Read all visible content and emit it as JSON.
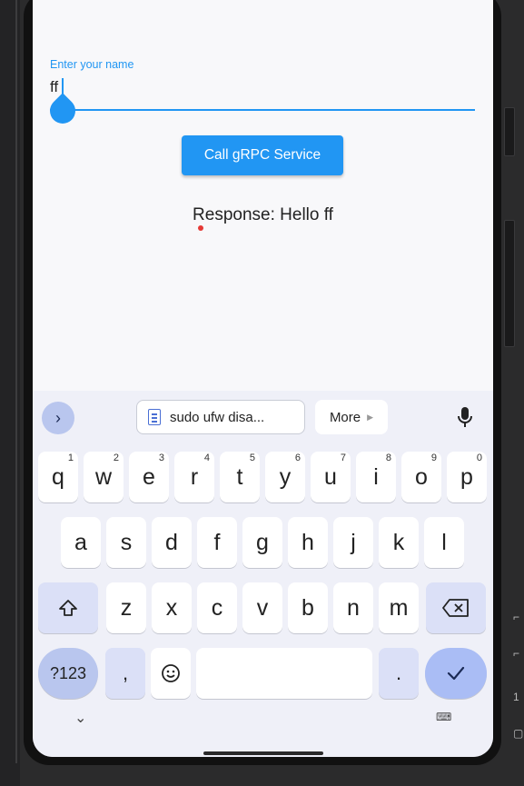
{
  "app": {
    "field_label": "Enter your name",
    "field_value": "ff",
    "button_label": "Call gRPC Service",
    "response_text": "Response: Hello ff"
  },
  "keyboard": {
    "clipboard_chip": "sudo ufw disa...",
    "more_label": "More",
    "row1": [
      {
        "k": "q",
        "n": "1"
      },
      {
        "k": "w",
        "n": "2"
      },
      {
        "k": "e",
        "n": "3"
      },
      {
        "k": "r",
        "n": "4"
      },
      {
        "k": "t",
        "n": "5"
      },
      {
        "k": "y",
        "n": "6"
      },
      {
        "k": "u",
        "n": "7"
      },
      {
        "k": "i",
        "n": "8"
      },
      {
        "k": "o",
        "n": "9"
      },
      {
        "k": "p",
        "n": "0"
      }
    ],
    "row2": [
      "a",
      "s",
      "d",
      "f",
      "g",
      "h",
      "j",
      "k",
      "l"
    ],
    "row3": [
      "z",
      "x",
      "c",
      "v",
      "b",
      "n",
      "m"
    ],
    "sym_label": "?123",
    "comma": ",",
    "period": "."
  },
  "colors": {
    "accent": "#2196f3",
    "keyboard_bg": "#eff0f8",
    "enter_key": "#aabdf5"
  },
  "icons": [
    "chevron-right-icon",
    "clipboard-icon",
    "mic-icon",
    "shift-icon",
    "backspace-icon",
    "emoji-icon",
    "check-icon",
    "chevron-down-icon",
    "keyboard-icon"
  ]
}
